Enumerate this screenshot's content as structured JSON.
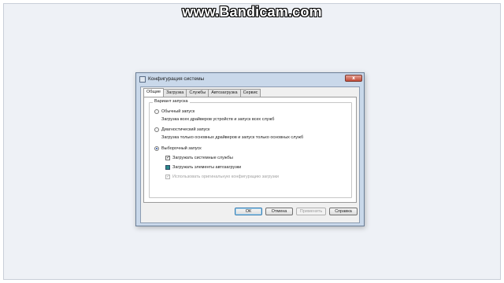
{
  "watermark": "www.Bandicam.com",
  "window": {
    "title": "Конфигурация системы",
    "close_glyph": "x"
  },
  "tabs": [
    {
      "label": "Общие",
      "active": true
    },
    {
      "label": "Загрузка",
      "active": false
    },
    {
      "label": "Службы",
      "active": false
    },
    {
      "label": "Автозагрузка",
      "active": false
    },
    {
      "label": "Сервис",
      "active": false
    }
  ],
  "group": {
    "label": "Вариант запуска",
    "options": [
      {
        "label": "Обычный запуск",
        "description": "Загрузка всех драйверов устройств и запуск всех служб",
        "selected": false
      },
      {
        "label": "Диагностический запуск",
        "description": "Загрузка только основных драйверов и запуск только основных служб",
        "selected": false
      },
      {
        "label": "Выборочный запуск",
        "description": "",
        "selected": true
      }
    ],
    "checkboxes": [
      {
        "label": "Загружать системные службы",
        "state": "checked",
        "enabled": true
      },
      {
        "label": "Загружать элементы автозагрузки",
        "state": "indeterminate",
        "enabled": true
      },
      {
        "label": "Использовать оригинальную конфигурацию загрузки",
        "state": "checked",
        "enabled": false
      }
    ]
  },
  "buttons": {
    "ok": "ОК",
    "cancel": "Отмена",
    "apply": "Применить",
    "help": "Справка"
  },
  "colors": {
    "desktop": "#eef1f6",
    "window_frame": "#c9d8ea",
    "radio_selected": "#2a56a6",
    "indeterminate_fill": "#2a8a8a"
  }
}
